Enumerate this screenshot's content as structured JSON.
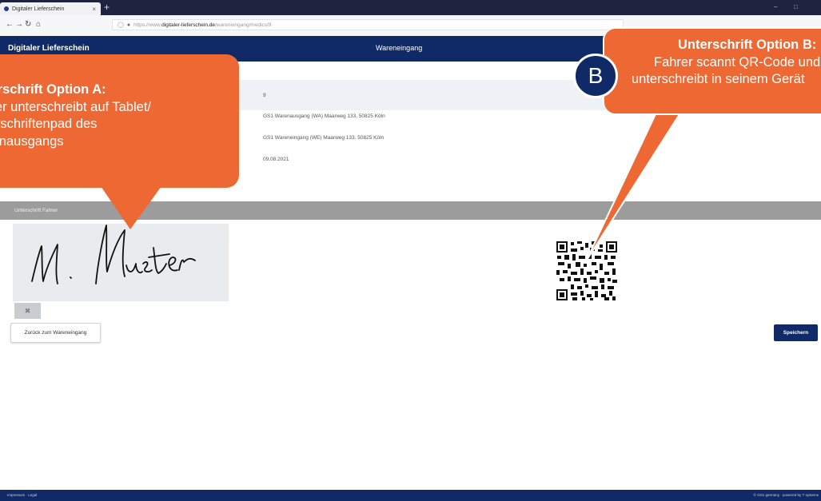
{
  "browser": {
    "tab_title": "Digitaler Lieferschein",
    "tab_close": "×",
    "new_tab": "+",
    "url_prefix": "https://www.",
    "url_domain": "digitaler-lieferschein.de",
    "url_path": "/wareneingang/medics/9",
    "min": "–",
    "max": "□",
    "close": "✕"
  },
  "app": {
    "name": "Digitaler Lieferschein",
    "page_title": "Wareneingang"
  },
  "details": {
    "number": "9",
    "warenausgang": "GS1 Warenausgang (WA) Maarweg 133, 50825 Köln",
    "wareneingang": "GS1 Wareneingang (WE) Maarweg 133, 50825 Köln",
    "date": "09.08.2021"
  },
  "signature": {
    "section_label": "Unterschrift Fahrer",
    "handwriting": "M. Muster"
  },
  "buttons": {
    "back": "Zurück zum Wareneingang",
    "save": "Speichern"
  },
  "footer": {
    "left": "Impressum · Legal",
    "right": "© GS1 germany · powered by 7·systems"
  },
  "callouts": {
    "a_title": "Unterschrift Option A:",
    "a_line1": "Fahrer unterschreibt auf Tablet/",
    "a_line2": "Unterschriftenpad des",
    "a_line3": "Warenausgangs",
    "b_badge": "B",
    "b_title": "Unterschrift Option B:",
    "b_line1": "Fahrer scannt QR-Code und",
    "b_line2": "unterschreibt in seinem Gerät"
  },
  "colors": {
    "primary": "#0f2a66",
    "callout": "#ee6833",
    "section_bar": "#9c9c9c"
  }
}
